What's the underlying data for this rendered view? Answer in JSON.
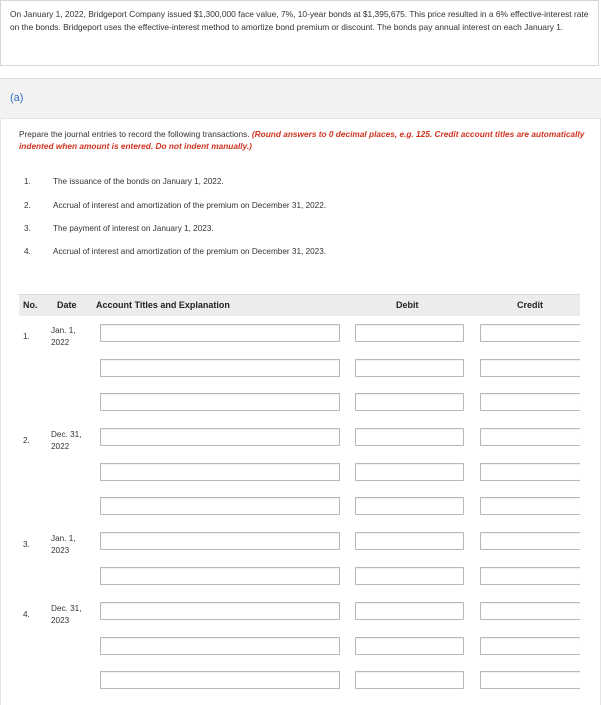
{
  "problem": {
    "text": "On January 1, 2022, Bridgeport Company issued $1,300,000 face value, 7%, 10-year bonds at $1,395,675. This price resulted in a 6% effective-interest rate on the bonds. Bridgeport uses the effective-interest method to amortize bond premium or discount. The bonds pay annual interest on each January 1."
  },
  "part": {
    "label": "(a)"
  },
  "instructions": {
    "lead": "Prepare the journal entries to record the following transactions. ",
    "note": "(Round answers to 0 decimal places, e.g. 125. Credit account titles are automatically indented when amount is entered. Do not indent manually.)"
  },
  "tasks": [
    {
      "num": "1.",
      "text": "The issuance of the bonds on January 1, 2022."
    },
    {
      "num": "2.",
      "text": "Accrual of interest and amortization of the premium on December 31, 2022."
    },
    {
      "num": "3.",
      "text": "The payment of interest on January 1, 2023."
    },
    {
      "num": "4.",
      "text": "Accrual of interest and amortization of the premium on December 31, 2023."
    }
  ],
  "table": {
    "headers": {
      "no": "No.",
      "date": "Date",
      "account": "Account Titles and Explanation",
      "debit": "Debit",
      "credit": "Credit"
    },
    "entries": [
      {
        "no": "1.",
        "date_line1": "Jan. 1,",
        "date_line2": "2022"
      },
      {
        "no": "2.",
        "date_line1": "Dec. 31,",
        "date_line2": "2022"
      },
      {
        "no": "3.",
        "date_line1": "Jan. 1,",
        "date_line2": "2023"
      },
      {
        "no": "4.",
        "date_line1": "Dec. 31,",
        "date_line2": "2023"
      }
    ]
  },
  "colors": {
    "accent": "#2f6fbf",
    "warning": "#d0321e",
    "header_bg": "#ececec"
  }
}
